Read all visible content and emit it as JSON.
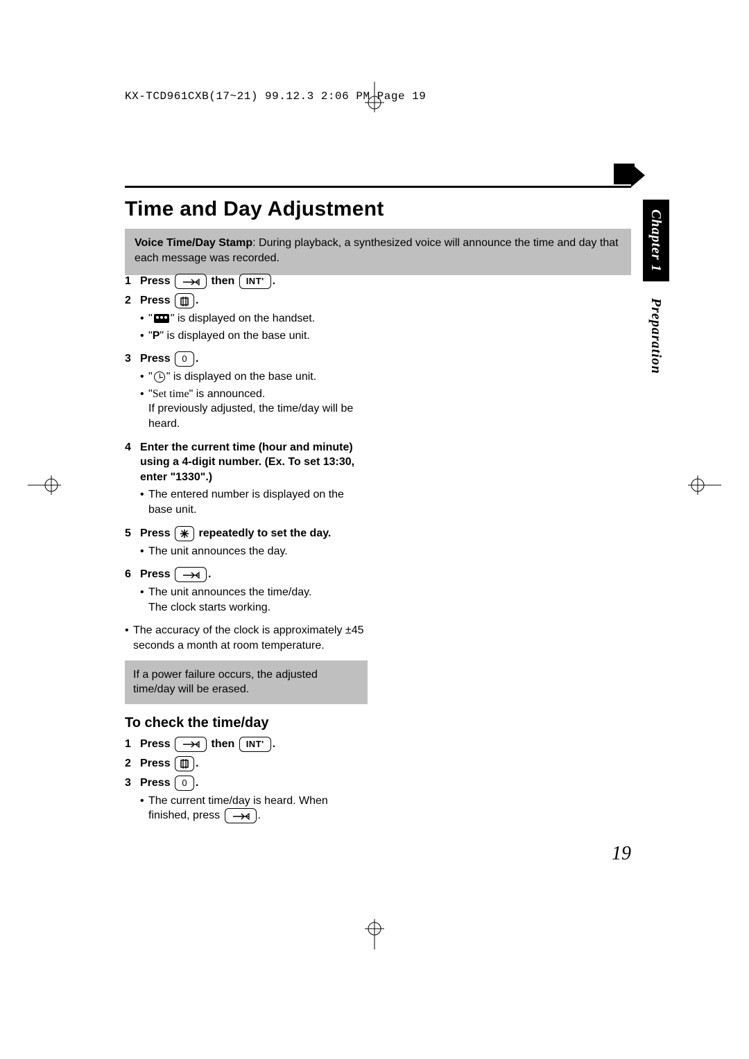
{
  "header_line": "KX-TCD961CXB(17~21)  99.12.3  2:06 PM  Page 19",
  "title": "Time and Day Adjustment",
  "intro_bold": "Voice Time/Day Stamp",
  "intro_rest": ": During playback, a synthesized voice will announce the time and day that each message was recorded.",
  "side_tab_chapter": "Chapter 1",
  "side_tab_section": "Preparation",
  "page_number": "19",
  "step1_press": "Press ",
  "step1_then": " then ",
  "step1_int": "INT'",
  "step1_dot": ".",
  "step2_press": "Press ",
  "step2_dot": ".",
  "step2_b1_a": "\"",
  "step2_b1_b": "\" is displayed on the handset.",
  "step2_b2_a": "\"",
  "step2_b2_p": "P",
  "step2_b2_b": "\" is displayed on the base unit.",
  "step3_press": "Press ",
  "step3_key": "0",
  "step3_dot": ".",
  "step3_b1_a": "\"",
  "step3_b1_b": "\" is displayed on the base unit.",
  "step3_b2_a": "\"",
  "step3_b2_set": "Set time",
  "step3_b2_b": "\" is announced.",
  "step3_b2_c": "If previously adjusted, the time/day will be heard.",
  "step4_instr": "Enter the current time (hour and minute) using a 4-digit number. (Ex. To set 13:30, enter \"1330\".)",
  "step4_b1": "The entered number is displayed on the base unit.",
  "step5_press": "Press ",
  "step5_rest": " repeatedly to set the day.",
  "step5_b1": "The unit announces the day.",
  "step6_press": "Press ",
  "step6_dot": ".",
  "step6_b1": "The unit announces the time/day.",
  "step6_b2": "The clock starts working.",
  "accuracy_note": "The accuracy of the clock is approximately ±45 seconds a month at room temperature.",
  "power_fail_note": "If a power failure occurs, the adjusted time/day will be erased.",
  "check_title": "To check the time/day",
  "check1_press": "Press ",
  "check1_then": " then ",
  "check1_dot": ".",
  "check2_press": "Press ",
  "check2_dot": ".",
  "check3_press": "Press ",
  "check3_key": "0",
  "check3_dot": ".",
  "check3_b1_a": "The current time/day is heard. When finished, press ",
  "check3_b1_b": "."
}
